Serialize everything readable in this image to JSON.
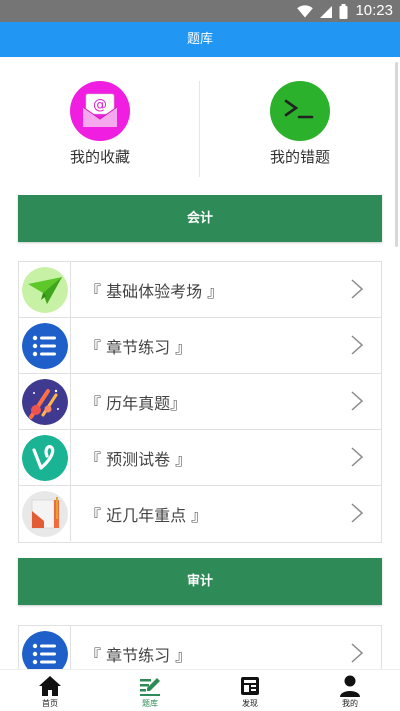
{
  "status_bar": {
    "time": "10:23"
  },
  "app_bar": {
    "title": "题库"
  },
  "top_items": [
    {
      "label": "我的收藏",
      "icon": "mail-at-icon",
      "color": "#f01ee0"
    },
    {
      "label": "我的错题",
      "icon": "terminal-icon",
      "color": "#2bb12b"
    }
  ],
  "sections": [
    {
      "title": "会计",
      "rows": [
        {
          "label": "『 基础体验考场 』",
          "icon": "paper-plane-icon"
        },
        {
          "label": "『 章节练习 』",
          "icon": "list-icon"
        },
        {
          "label": "『 历年真题』",
          "icon": "meteor-icon"
        },
        {
          "label": "『 预测试卷 』",
          "icon": "vine-icon"
        },
        {
          "label": "『 近几年重点 』",
          "icon": "notebook-icon"
        }
      ]
    },
    {
      "title": "审计",
      "rows": [
        {
          "label": "『 章节练习 』",
          "icon": "list-icon"
        }
      ]
    }
  ],
  "tabs": [
    {
      "label": "首页",
      "icon": "home-icon",
      "active": false
    },
    {
      "label": "题库",
      "icon": "edit-icon",
      "active": true
    },
    {
      "label": "发现",
      "icon": "news-icon",
      "active": false
    },
    {
      "label": "我的",
      "icon": "person-icon",
      "active": false
    }
  ],
  "colors": {
    "primary": "#2196f3",
    "accent": "#2e8b57"
  }
}
